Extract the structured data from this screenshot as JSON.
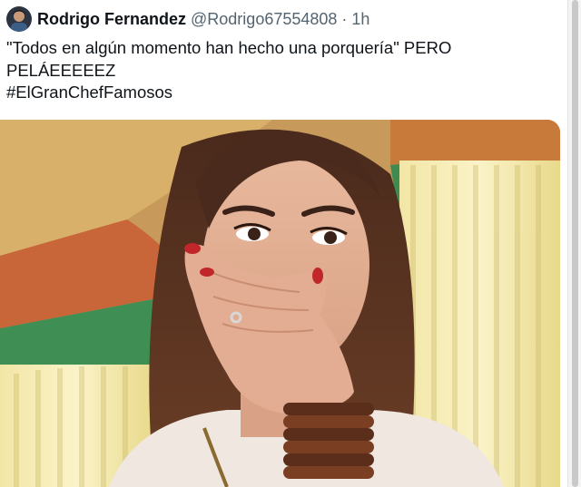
{
  "tweet": {
    "author": {
      "display_name": "Rodrigo Fernandez",
      "handle": "@Rodrigo67554808",
      "separator": "·",
      "time": "1h"
    },
    "text_lines": [
      "\"Todos en algún momento han hecho una porquería\" PERO",
      "PELÁEEEEEZ"
    ],
    "hashtag": "#ElGranChefFamosos",
    "media": {
      "description_icon": "photo-woman-covering-mouth"
    }
  },
  "colors": {
    "name": "#0f1419",
    "meta": "#536471",
    "background": "#ffffff"
  }
}
